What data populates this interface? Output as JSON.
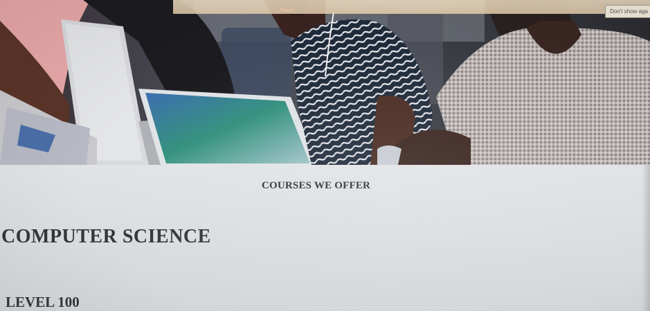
{
  "banner": {
    "dont_show_label": "Don't show aga"
  },
  "main": {
    "section_heading": "COURSES WE OFFER",
    "course_title": "COMPUTER SCIENCE",
    "level_title": "LEVEL 100"
  }
}
